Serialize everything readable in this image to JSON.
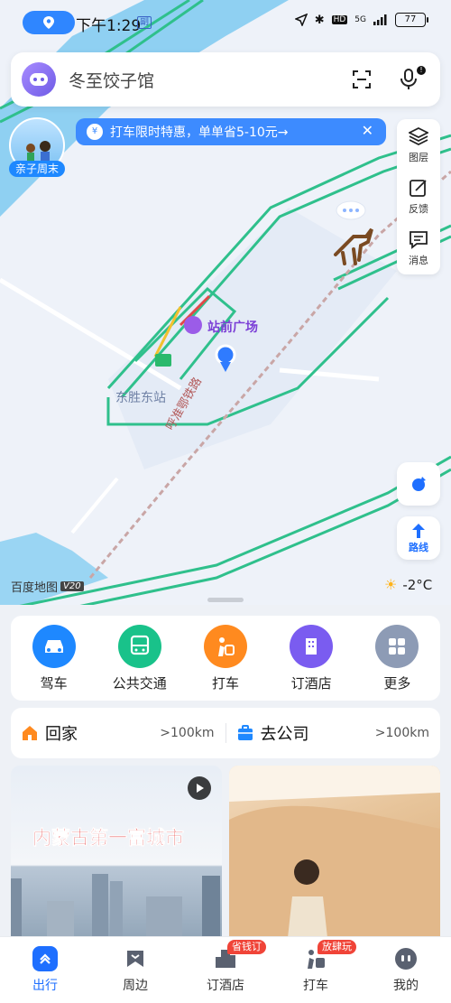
{
  "status_bar": {
    "time": "下午1:29",
    "small_badge": "副",
    "network": "5G",
    "hd": "HD",
    "battery": "77"
  },
  "search": {
    "query": "冬至饺子馆"
  },
  "promo": {
    "tag": "亲子周末",
    "banner": "打车限时特惠，单单省5-10元→"
  },
  "map_tools": {
    "layers": "图层",
    "feedback": "反馈",
    "messages": "消息"
  },
  "map": {
    "poi_plaza": "站前广场",
    "poi_station": "东胜东站",
    "railway": "呼准鄂铁路",
    "brand": "百度地图",
    "brand_version": "V20",
    "weather": "-2°C",
    "route_label": "路线"
  },
  "quick_actions": [
    {
      "label": "驾车",
      "color": "#1e88ff"
    },
    {
      "label": "公共交通",
      "color": "#19c28a"
    },
    {
      "label": "打车",
      "color": "#ff8a1f"
    },
    {
      "label": "订酒店",
      "color": "#7a5cf0"
    },
    {
      "label": "更多",
      "color": "#8d9bb5"
    }
  ],
  "addresses": {
    "home": {
      "label": "回家",
      "distance": ">100km",
      "color": "#ff8a1f"
    },
    "work": {
      "label": "去公司",
      "distance": ">100km",
      "color": "#1e88ff"
    }
  },
  "feed": {
    "left_title": "内蒙古第一富城市"
  },
  "tabbar": {
    "tabs": [
      {
        "label": "出行"
      },
      {
        "label": "周边"
      },
      {
        "label": "订酒店",
        "badge": "省钱订"
      },
      {
        "label": "打车",
        "badge": "放肆玩"
      },
      {
        "label": "我的"
      }
    ]
  }
}
